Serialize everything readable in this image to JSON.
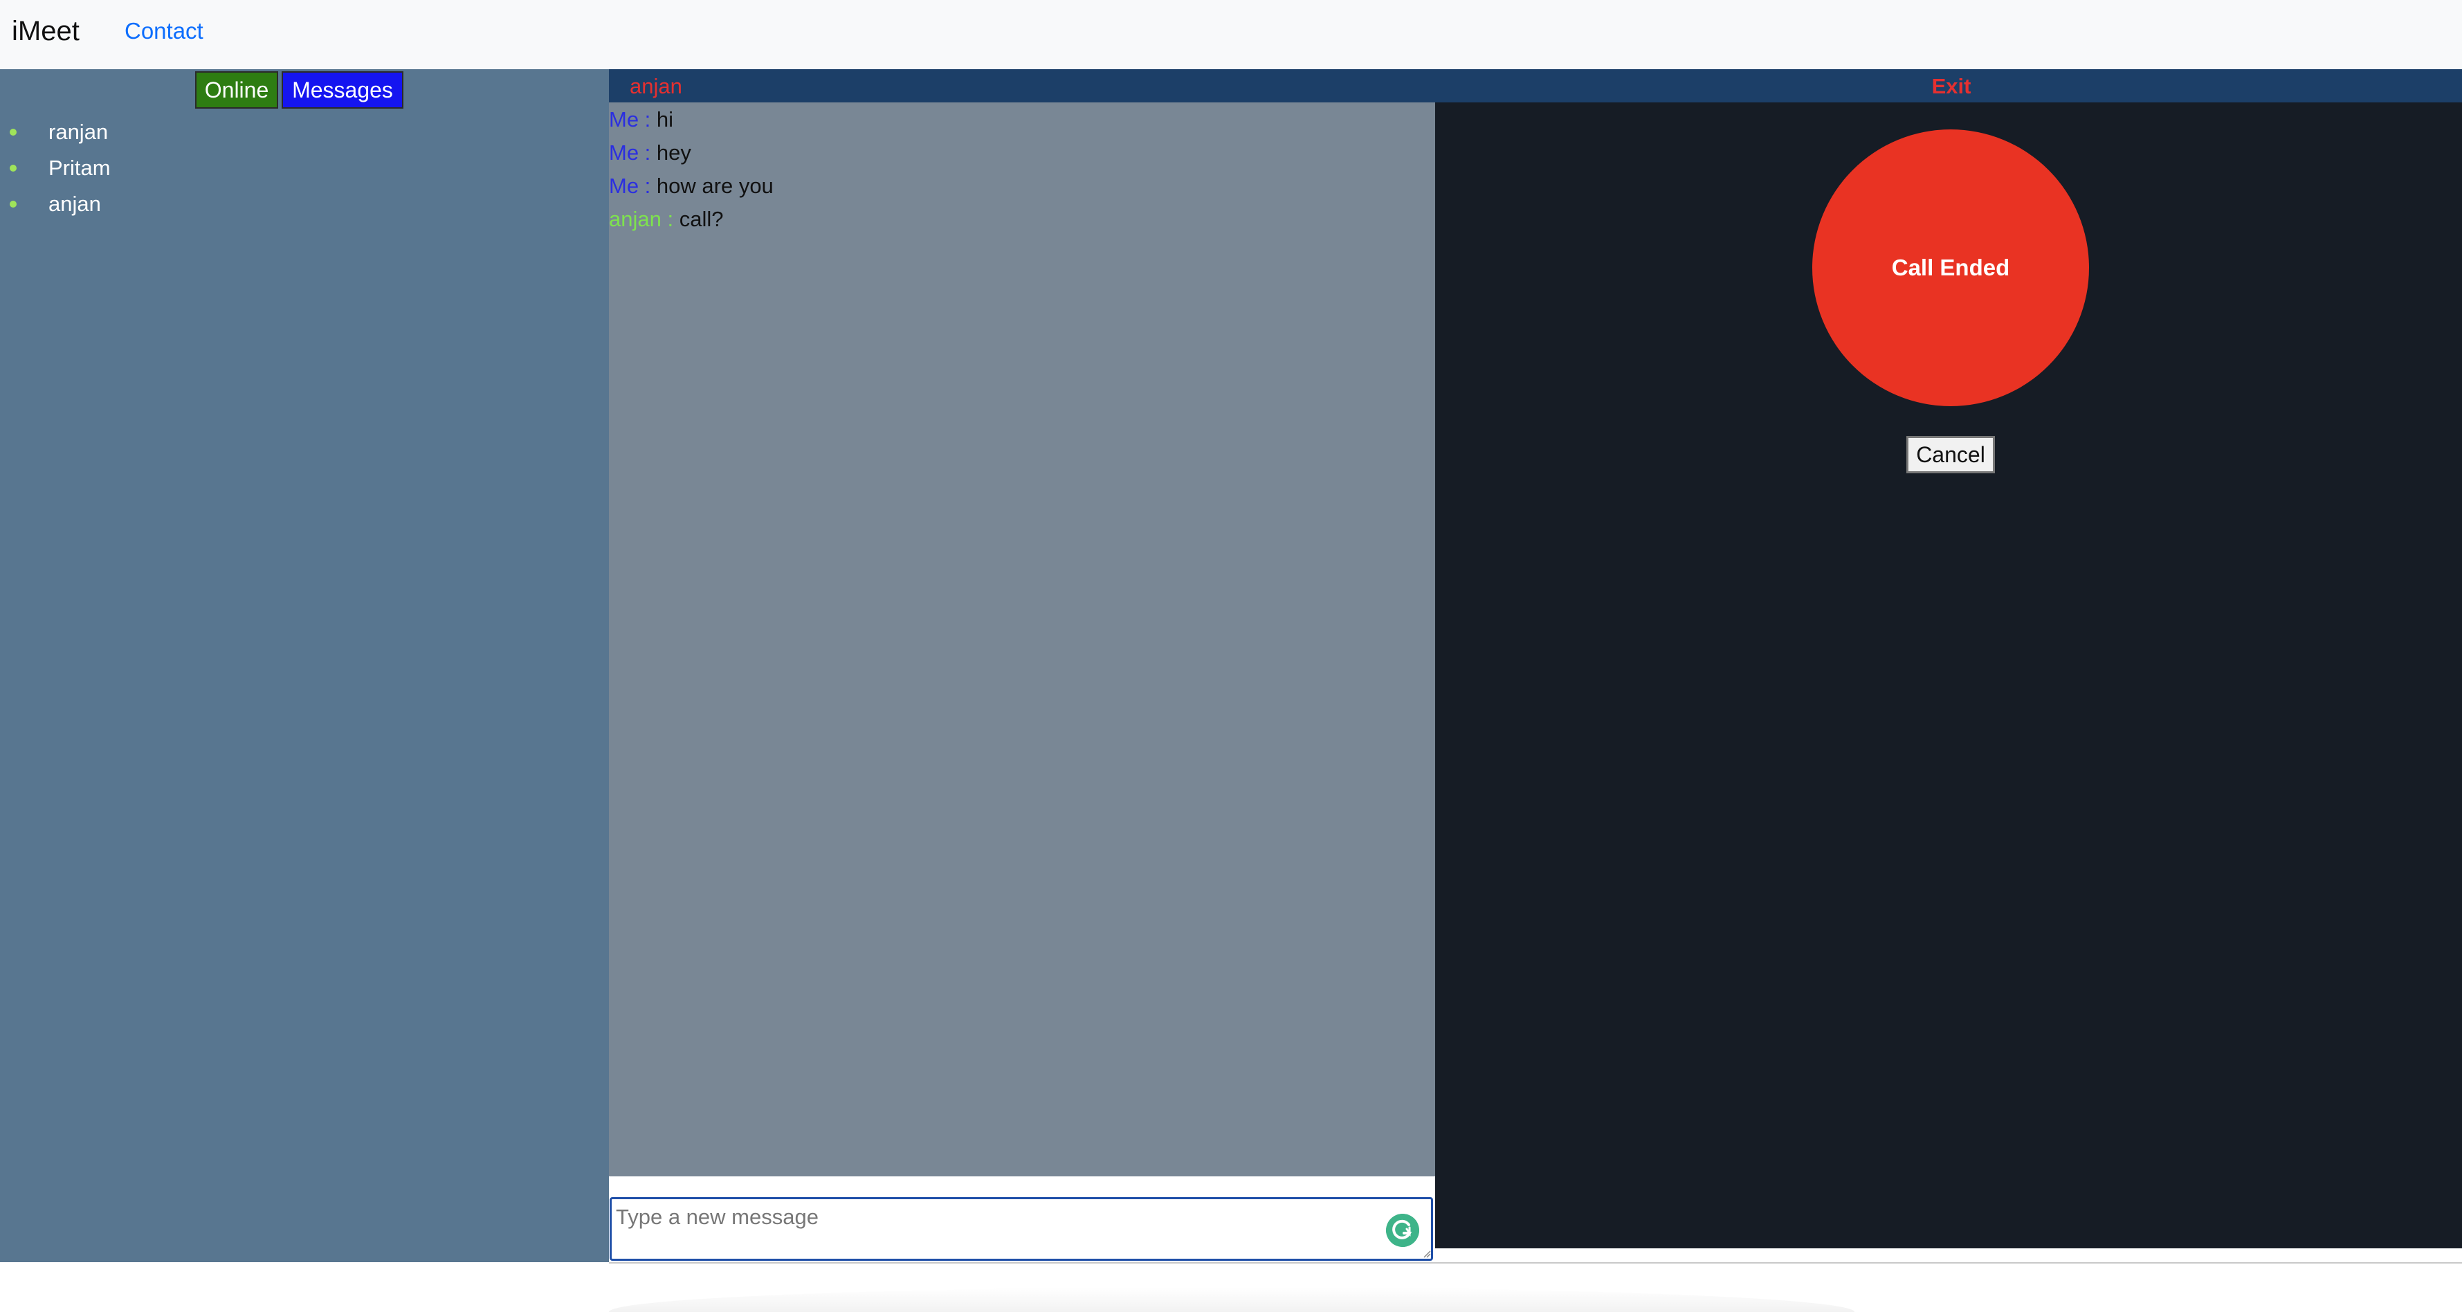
{
  "navbar": {
    "brand": "iMeet",
    "links": [
      {
        "label": "Contact"
      }
    ]
  },
  "sidebar": {
    "tabs": [
      {
        "label": "Online",
        "color": "#2e7d12"
      },
      {
        "label": "Messages",
        "color": "#1515f0"
      }
    ],
    "users": [
      {
        "name": "ranjan"
      },
      {
        "name": "Pritam"
      },
      {
        "name": "anjan"
      }
    ]
  },
  "chat": {
    "peer_name": "anjan",
    "exit_label": "Exit",
    "messages": [
      {
        "sender": "Me :",
        "text": "hi",
        "sender_color": "#2b2fe0"
      },
      {
        "sender": "Me :",
        "text": "hey",
        "sender_color": "#2b2fe0"
      },
      {
        "sender": "Me :",
        "text": "how are you",
        "sender_color": "#2b2fe0"
      },
      {
        "sender": "anjan :",
        "text": "call?",
        "sender_color": "#7ee24e"
      }
    ],
    "input": {
      "value": "",
      "placeholder": "Type a new message"
    },
    "grammar_icon": "grammarly-icon"
  },
  "call": {
    "status": "Call Ended",
    "status_color": "#e93323",
    "cancel_label": "Cancel"
  }
}
